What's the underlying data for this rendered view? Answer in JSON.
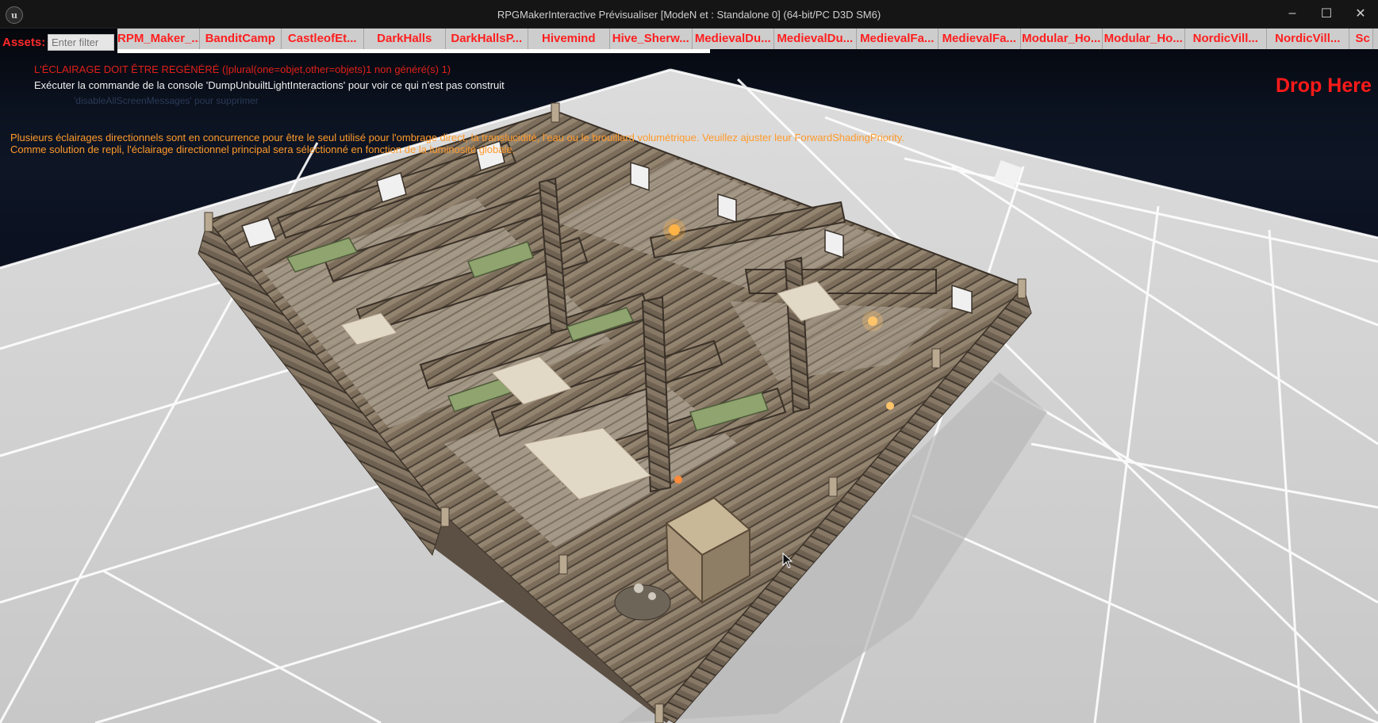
{
  "window": {
    "title": "RPGMakerInteractive Prévisualiser [ModeN et : Standalone 0]  (64-bit/PC D3D SM6)",
    "controls": {
      "minimize": "–",
      "maximize": "☐",
      "close": "✕"
    }
  },
  "assets": {
    "label": "Assets:",
    "filter_placeholder": "Enter filter",
    "tabs": [
      "RPM_Maker_...",
      "BanditCamp",
      "CastleofEt...",
      "DarkHalls",
      "DarkHallsP...",
      "Hivemind",
      "Hive_Sherw...",
      "MedievalDu...",
      "MedievalDu...",
      "MedievalFa...",
      "MedievalFa...",
      "Modular_Ho...",
      "Modular_Ho...",
      "NordicVill...",
      "NordicVill...",
      "Sc"
    ],
    "loading_progress": 0.47
  },
  "messages": {
    "lighting_rebuild": "L'ÉCLAIRAGE DOIT ÊTRE REGÉNÉRÉ (|plural(one=objet,other=objets)1 non généré(s) 1)",
    "console_hint": "Exécuter la commande de la console 'DumpUnbuiltLightInteractions' pour voir ce qui n'est pas construit",
    "suppress_hint": "'disableAllScreenMessages' pour supprimer",
    "directional_warning_1": "Plusieurs éclairages directionnels sont en concurrence pour être le seul utilisé pour l'ombrage direct, la translucidité, l'eau ou le brouillard volumétrique. Veuillez ajuster leur ForwardShadingPriority.",
    "directional_warning_2": "Comme solution de repli, l'éclairage directionnel principal sera sélectionné en fonction de la luminosité globale."
  },
  "drop_zone": {
    "label": "Drop Here"
  },
  "colors": {
    "accent_red": "#ff1f1f",
    "warning_orange": "#ff9a2a",
    "tab_bar": "#c9c9c9",
    "floor": "#d9d9d9",
    "wood": "#8a7a66"
  },
  "icons": {
    "app_logo": "unreal-logo-icon",
    "cursor": "mouse-cursor-icon"
  }
}
